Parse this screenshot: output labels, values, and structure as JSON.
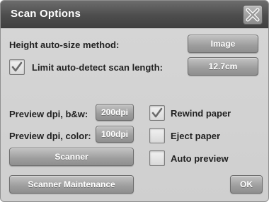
{
  "dialog": {
    "title": "Scan Options"
  },
  "height_auto_size": {
    "label": "Height auto-size method:",
    "value": "Image"
  },
  "limit_auto_detect": {
    "label": "Limit auto-detect scan length:",
    "checked": true,
    "value": "12.7cm"
  },
  "preview_dpi_bw": {
    "label": "Preview dpi, b&w:",
    "value": "200dpi"
  },
  "preview_dpi_color": {
    "label": "Preview dpi, color:",
    "value": "100dpi"
  },
  "buttons": {
    "scanner": "Scanner",
    "scanner_maintenance": "Scanner Maintenance",
    "ok": "OK"
  },
  "checkboxes": {
    "rewind_paper": {
      "label": "Rewind paper",
      "checked": true
    },
    "eject_paper": {
      "label": "Eject paper",
      "checked": false
    },
    "auto_preview": {
      "label": "Auto preview",
      "checked": false
    }
  },
  "icons": {
    "close": "close-icon",
    "check": "checkmark-icon"
  },
  "colors": {
    "titlebar": "#4d4d4d",
    "dialog_bg": "#d3d3d3",
    "button_gray": "#9d9d9d",
    "button_text": "#ffffff",
    "label_text": "#222222"
  }
}
